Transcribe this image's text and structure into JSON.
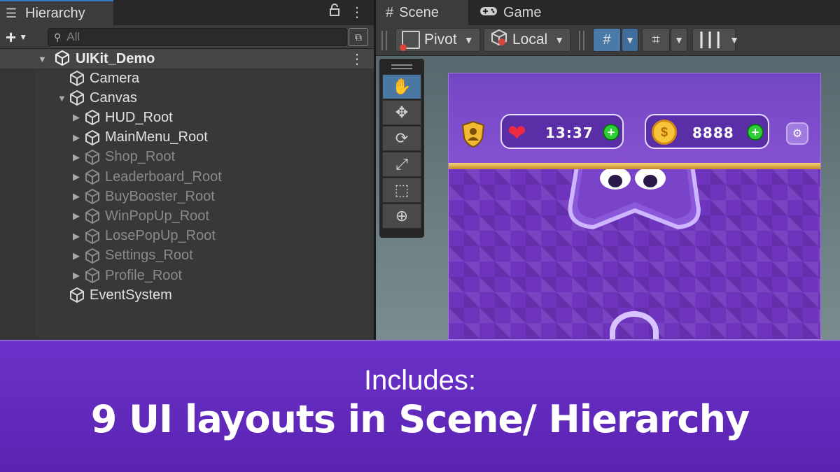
{
  "hierarchy": {
    "tab_title": "Hierarchy",
    "search": {
      "placeholder": "All"
    },
    "scene_name": "UIKit_Demo",
    "items": [
      {
        "label": "Camera",
        "dim": false,
        "expandable": false,
        "indent": 1
      },
      {
        "label": "Canvas",
        "dim": false,
        "expandable": true,
        "expanded": true,
        "indent": 1
      },
      {
        "label": "HUD_Root",
        "dim": false,
        "expandable": true,
        "indent": 2
      },
      {
        "label": "MainMenu_Root",
        "dim": false,
        "expandable": true,
        "indent": 2
      },
      {
        "label": "Shop_Root",
        "dim": true,
        "expandable": true,
        "indent": 2
      },
      {
        "label": "Leaderboard_Root",
        "dim": true,
        "expandable": true,
        "indent": 2
      },
      {
        "label": "BuyBooster_Root",
        "dim": true,
        "expandable": true,
        "indent": 2
      },
      {
        "label": "WinPopUp_Root",
        "dim": true,
        "expandable": true,
        "indent": 2
      },
      {
        "label": "LosePopUp_Root",
        "dim": true,
        "expandable": true,
        "indent": 2
      },
      {
        "label": "Settings_Root",
        "dim": true,
        "expandable": true,
        "indent": 2
      },
      {
        "label": "Profile_Root",
        "dim": true,
        "expandable": true,
        "indent": 2
      },
      {
        "label": "EventSystem",
        "dim": false,
        "expandable": false,
        "indent": 1
      }
    ]
  },
  "scene_view": {
    "tabs": [
      {
        "label": "Scene",
        "icon": "grid-hash-icon",
        "active": true
      },
      {
        "label": "Game",
        "icon": "gamepad-icon",
        "active": false
      }
    ],
    "toolbar": {
      "pivot_label": "Pivot",
      "space_label": "Local"
    },
    "tools": [
      "hand-tool",
      "move-tool",
      "rotate-tool",
      "scale-tool",
      "rect-tool",
      "transform-tool"
    ],
    "game_hud": {
      "timer": "13:37",
      "coins": "8888"
    }
  },
  "banner": {
    "subtitle": "Includes:",
    "title": "9 UI layouts in Scene/ Hierarchy"
  },
  "colors": {
    "accent_blue": "#3a79bb",
    "banner_purple": "#6a32c8",
    "game_purple": "#7a3fc6",
    "plus_green": "#2fcf3a"
  }
}
